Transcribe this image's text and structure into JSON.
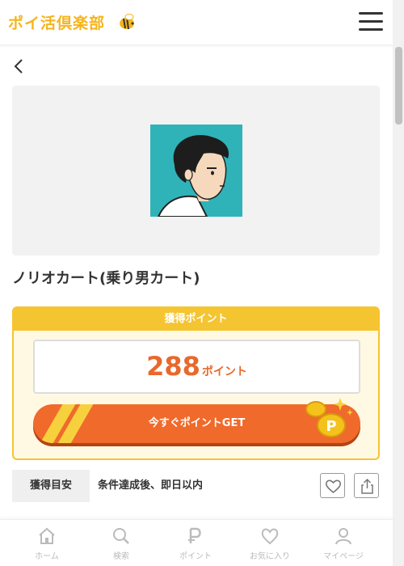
{
  "header": {
    "logo_text": "ポイ活倶楽部",
    "logo_icon": "bee-icon",
    "menu_icon": "hamburger-menu-icon"
  },
  "nav": {
    "back_icon": "chevron-left-icon"
  },
  "offer": {
    "title": "ノリオカート(乗り男カート)",
    "points_heading": "獲得ポイント",
    "points_value": "288",
    "points_unit": "ポイント",
    "get_button_label": "今すぐポイントGET",
    "estimate_label": "獲得目安",
    "estimate_value": "条件達成後、即日以内"
  },
  "tabs": [
    {
      "label": "ホーム",
      "icon": "home-icon"
    },
    {
      "label": "検索",
      "icon": "search-icon"
    },
    {
      "label": "ポイント",
      "icon": "point-p-icon"
    },
    {
      "label": "お気に入り",
      "icon": "heart-icon"
    },
    {
      "label": "マイページ",
      "icon": "person-icon"
    }
  ],
  "colors": {
    "brand_yellow": "#f5c431",
    "accent_orange": "#f06a2b",
    "points_text": "#e8692c",
    "thumbnail_bg": "#2fb3b8",
    "tab_inactive": "#bbbbbb"
  }
}
